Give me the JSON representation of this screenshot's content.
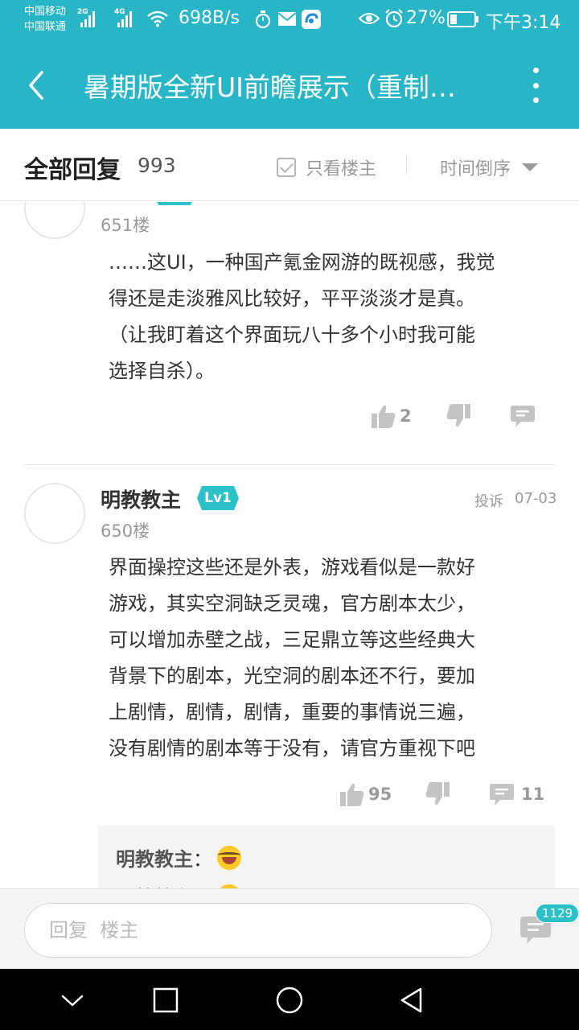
{
  "status_bar": {
    "carrier1": "中国移动",
    "carrier2": "中国联通",
    "sig1_gen": "2G",
    "sig2_gen": "4G",
    "net_speed": "698B/s",
    "battery": "27%",
    "time": "下午3:14"
  },
  "header": {
    "title": "暑期版全新UI前瞻展示（重制…"
  },
  "filter": {
    "all_replies_label": "全部回复",
    "reply_count": "993",
    "only_op_label": "只看楼主",
    "sort_label": "时间倒序"
  },
  "posts": [
    {
      "floor": "651楼",
      "lines": [
        "……这UI，一种国产氪金网游的既视感，我觉",
        "得还是走淡雅风比较好，平平淡淡才是真。",
        "（让我盯着这个界面玩八十多个小时我可能",
        "选择自杀）。"
      ],
      "like_count": "2"
    },
    {
      "username": "明教教主",
      "level": "Lv1",
      "report_label": "投诉",
      "date": "07-03",
      "floor": "650楼",
      "lines": [
        "界面操控这些还是外表，游戏看似是一款好",
        "游戏，其实空洞缺乏灵魂，官方剧本太少，",
        "可以增加赤壁之战，三足鼎立等这些经典大",
        "背景下的剧本，光空洞的剧本还不行，要加",
        "上剧情，剧情，剧情，重要的事情说三遍，",
        "没有剧情的剧本等于没有，请官方重视下吧"
      ],
      "like_count": "95",
      "comment_count": "11",
      "sub_replies": [
        {
          "author": "明教教主",
          "sep": "：",
          "text": ""
        },
        {
          "author": "明教教主",
          "sep": "：",
          "text": ""
        }
      ]
    }
  ],
  "reply_bar": {
    "placeholder": "回复  楼主",
    "badge_count": "1129"
  },
  "icons": {
    "back": "back-arrow-icon",
    "more": "more-vertical-icon",
    "like": "thumbs-up-icon",
    "dislike": "thumbs-down-icon",
    "comment": "comment-icon",
    "emoji": "laughing-tears-emoji"
  },
  "colors": {
    "brand": "#28b6c7",
    "badge": "#2cc0c8",
    "muted": "#999999"
  }
}
